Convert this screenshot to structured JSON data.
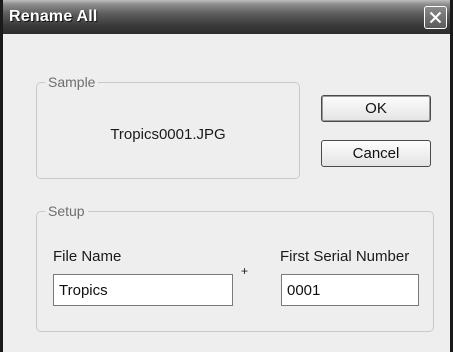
{
  "window": {
    "title": "Rename All"
  },
  "sample": {
    "legend": "Sample",
    "value": "Tropics0001.JPG"
  },
  "buttons": {
    "ok": "OK",
    "cancel": "Cancel"
  },
  "setup": {
    "legend": "Setup",
    "file_name_label": "File Name",
    "file_name_value": "Tropics",
    "plus": "+",
    "serial_label": "First Serial Number",
    "serial_value": "0001"
  },
  "icons": {
    "close": "close-icon"
  }
}
